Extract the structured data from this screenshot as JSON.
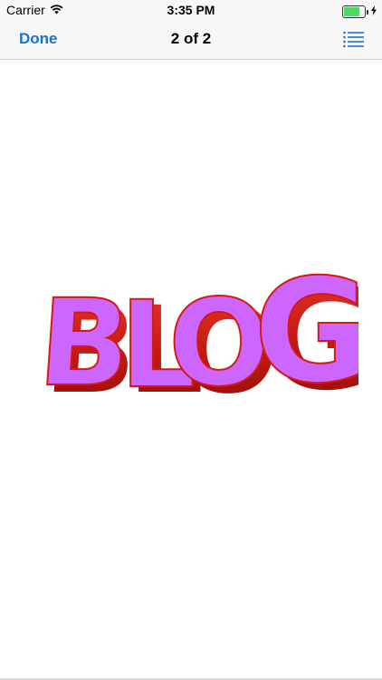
{
  "status_bar": {
    "carrier": "Carrier",
    "time": "3:35 PM",
    "icons": [
      "wifi-icon",
      "battery-icon",
      "charging-bolt-icon"
    ],
    "battery_level": 0.75
  },
  "nav": {
    "done_label": "Done",
    "title": "2 of 2",
    "list_icon": "list-icon"
  },
  "content": {
    "image_text": "BLOG",
    "colors": {
      "letter_face": "#cc66ff",
      "letter_extrusion": "#c41a12",
      "accent_blue": "#1a73c9"
    }
  }
}
